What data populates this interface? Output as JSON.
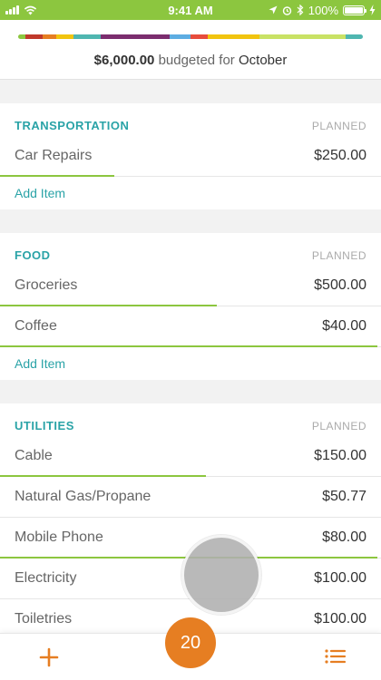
{
  "status_bar": {
    "time": "9:41 AM",
    "battery": "100%",
    "icons": [
      "signal-icon",
      "wifi-icon",
      "location-icon",
      "alarm-icon",
      "bluetooth-icon",
      "battery-icon",
      "charging-icon"
    ]
  },
  "header": {
    "budget_amount": "$6,000.00",
    "budget_text": "budgeted for",
    "month": "October",
    "bar_segments": [
      {
        "color": "#8cc63f",
        "share": 0.02
      },
      {
        "color": "#c0392b",
        "share": 0.05
      },
      {
        "color": "#e67e22",
        "share": 0.04
      },
      {
        "color": "#f1c40f",
        "share": 0.05
      },
      {
        "color": "#4fb6b0",
        "share": 0.08
      },
      {
        "color": "#7b2d6e",
        "share": 0.2
      },
      {
        "color": "#5dade2",
        "share": 0.06
      },
      {
        "color": "#e74c3c",
        "share": 0.05
      },
      {
        "color": "#f1c40f",
        "share": 0.15
      },
      {
        "color": "#c9e265",
        "share": 0.25
      },
      {
        "color": "#4fb6b0",
        "share": 0.05
      }
    ]
  },
  "groups": [
    {
      "title": "TRANSPORTATION",
      "planned_label": "PLANNED",
      "items": [
        {
          "name": "Car Repairs",
          "amount": "$250.00",
          "progress": 0.3
        }
      ],
      "add_label": "Add Item"
    },
    {
      "title": "FOOD",
      "planned_label": "PLANNED",
      "items": [
        {
          "name": "Groceries",
          "amount": "$500.00",
          "progress": 0.57
        },
        {
          "name": "Coffee",
          "amount": "$40.00",
          "progress": 0.99
        }
      ],
      "add_label": "Add Item"
    },
    {
      "title": "UTILITIES",
      "planned_label": "PLANNED",
      "items": [
        {
          "name": "Cable",
          "amount": "$150.00",
          "progress": 0.54
        },
        {
          "name": "Natural Gas/Propane",
          "amount": "$50.77",
          "progress": 0
        },
        {
          "name": "Mobile Phone",
          "amount": "$80.00",
          "progress": 0.99
        },
        {
          "name": "Electricity",
          "amount": "$100.00",
          "progress": 0
        },
        {
          "name": "Toiletries",
          "amount": "$100.00",
          "progress": 0
        }
      ],
      "add_label": ""
    }
  ],
  "tabbar": {
    "add_icon": "plus-icon",
    "count": "20",
    "list_icon": "list-icon",
    "accent_color": "#e67e22"
  },
  "colors": {
    "status_bar": "#8cc63f",
    "group_title": "#2aa3a7",
    "progress": "#8cc63f"
  }
}
